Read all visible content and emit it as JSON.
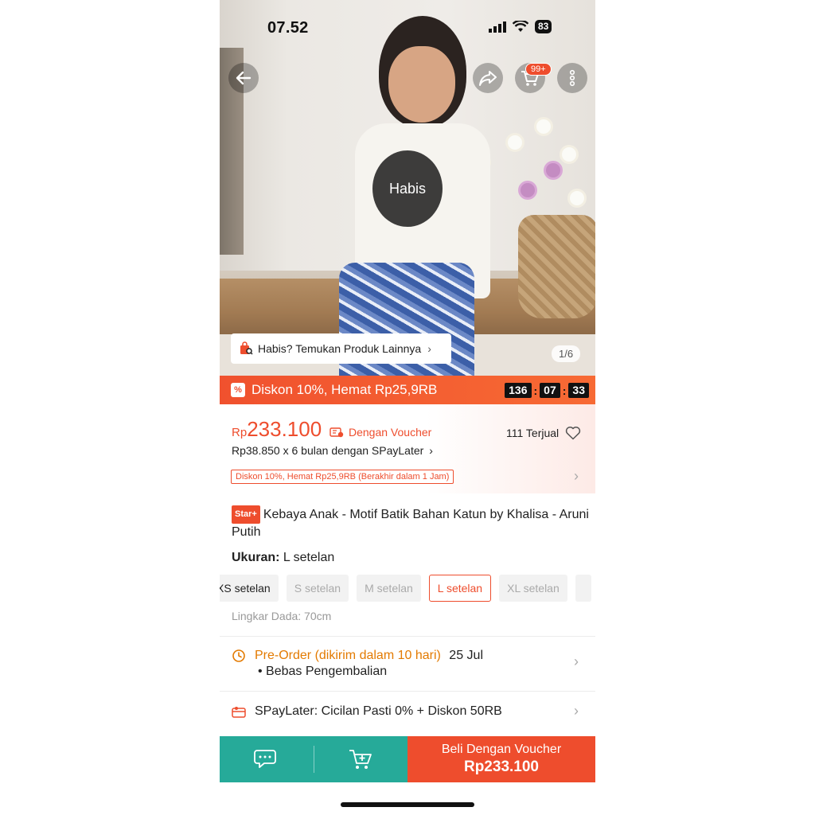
{
  "status_bar": {
    "time": "07.52",
    "battery": "83"
  },
  "header": {
    "cart_badge": "99+"
  },
  "gallery": {
    "sold_out_label": "Habis",
    "find_more_label": "Habis? Temukan Produk Lainnya",
    "image_counter": "1/6"
  },
  "flash_sale": {
    "label": "Diskon 10%, Hemat Rp25,9RB",
    "timer": {
      "hours": "136",
      "minutes": "07",
      "seconds": "33"
    }
  },
  "price": {
    "currency": "Rp",
    "amount": "233.100",
    "voucher_label": "Dengan Voucher",
    "sold_count": "111 Terjual",
    "installment": "Rp38.850 x 6 bulan dengan SPayLater",
    "promo": "Diskon 10%, Hemat Rp25,9RB (Berakhir dalam 1 Jam)"
  },
  "product": {
    "badge": "Star+",
    "title": "Kebaya Anak - Motif Batik Bahan Katun by Khalisa - Aruni Putih"
  },
  "size": {
    "label": "Ukuran:",
    "selected": "L setelan",
    "options": [
      "XS setelan",
      "S setelan",
      "M setelan",
      "L setelan",
      "XL setelan"
    ],
    "detail": "Lingkar Dada: 70cm"
  },
  "shipping": {
    "preorder": "Pre-Order (dikirim dalam 10 hari)",
    "date": "25 Jul",
    "returns": "• Bebas Pengembalian"
  },
  "spaylater": {
    "label": "SPayLater: Cicilan Pasti 0% + Diskon 50RB"
  },
  "bottom_bar": {
    "buy_line1": "Beli Dengan Voucher",
    "buy_line2": "Rp233.100"
  },
  "colors": {
    "accent": "#ee4d2d",
    "chat_green": "#26aa99",
    "preorder_orange": "#e37a00"
  }
}
